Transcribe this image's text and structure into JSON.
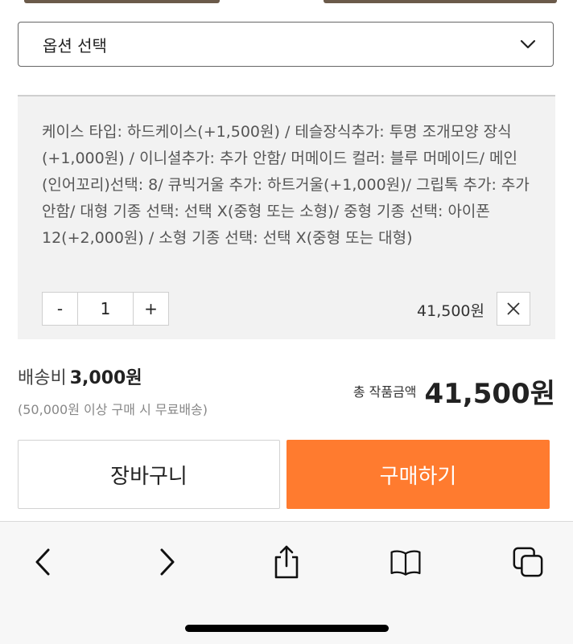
{
  "option_select": {
    "label": "옵션 선택"
  },
  "selected_option": {
    "description": "케이스 타입: 하드케이스(+1,500원) / 테슬장식추가: 투명 조개모양 장식(+1,000원) / 이니셜추가: 추가 안함/ 머메이드 컬러: 블루 머메이드/ 메인(인어꼬리)선택: 8/ 큐빅거울 추가: 하트거울(+1,000원)/ 그립톡 추가: 추가 안함/ 대형 기종 선택: 선택 X(중형 또는 소형)/ 중형 기종 선택: 아이폰 12(+2,000원) / 소형 기종 선택: 선택 X(중형 또는 대형)",
    "quantity": {
      "minus": "-",
      "value": "1",
      "plus": "+"
    },
    "price": "41,500원"
  },
  "shipping": {
    "label": "배송비",
    "amount": "3,000원",
    "note": "(50,000원 이상 구매 시 무료배송)"
  },
  "total": {
    "label": "총 작품금액",
    "amount": "41,500원"
  },
  "actions": {
    "cart": "장바구니",
    "buy": "구매하기"
  },
  "colors": {
    "accent": "#ff7b2f",
    "panel": "#f2f2f2",
    "browser_bar": "#f7f7f7"
  },
  "browser_toolbar": {
    "icons": [
      "back-icon",
      "forward-icon",
      "share-icon",
      "bookmarks-icon",
      "tabs-icon"
    ]
  }
}
